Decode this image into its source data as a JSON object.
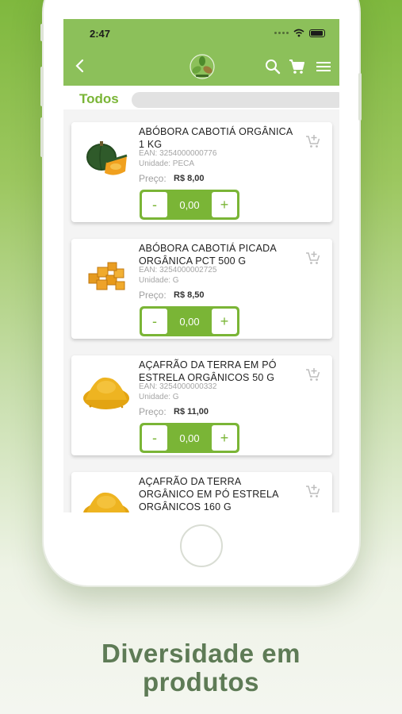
{
  "status_bar": {
    "time": "2:47"
  },
  "filter": {
    "label": "Todos"
  },
  "products": [
    {
      "name": "ABÓBORA CABOTIÁ ORGÂNICA 1 KG",
      "ean": "EAN: 3254000000776",
      "unit": "Unidade: PECA",
      "price_label": "Preço:",
      "price": "R$ 8,00",
      "minus": "-",
      "qty": "0,00",
      "plus": "+"
    },
    {
      "name": "ABÓBORA CABOTIÁ PICADA ORGÂNICA PCT 500 G",
      "ean": "EAN: 3254000002725",
      "unit": "Unidade: G",
      "price_label": "Preço:",
      "price": "R$ 8,50",
      "minus": "-",
      "qty": "0,00",
      "plus": "+"
    },
    {
      "name": "AÇAFRÃO DA TERRA EM PÓ ESTRELA ORGÂNICOS 50 G",
      "ean": "EAN: 3254000000332",
      "unit": "Unidade: G",
      "price_label": "Preço:",
      "price": "R$ 11,00",
      "minus": "-",
      "qty": "0,00",
      "plus": "+"
    },
    {
      "name": "AÇAFRÃO DA TERRA ORGÂNICO EM PÓ ESTRELA ORGÂNICOS 160 G"
    }
  ],
  "caption": {
    "line1": "Diversidade em",
    "line2": "produtos"
  },
  "colors": {
    "brand_green": "#7ab536",
    "appbar": "#8cc05a",
    "caption": "#5e7b56"
  },
  "icons": [
    "back-icon",
    "logo-icon",
    "search-icon",
    "cart-icon",
    "menu-icon",
    "add-to-cart-icon"
  ]
}
